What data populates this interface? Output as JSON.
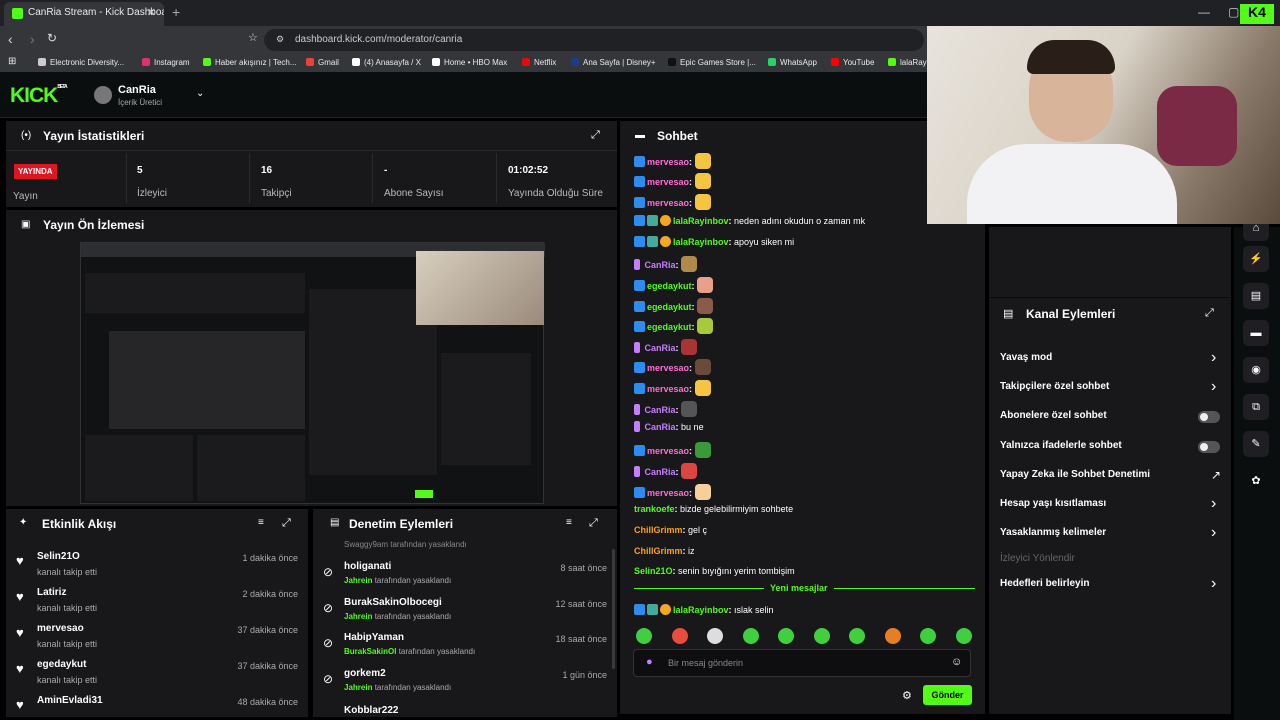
{
  "browser": {
    "tab_title": "CanRia Stream - Kick Dashboard",
    "url": "dashboard.kick.com/moderator/canria",
    "bookmarks": [
      "Electronic Diversity...",
      "Instagram",
      "Haber akışınız | Tech...",
      "Gmail",
      "(4) Anasayfa / X",
      "Home • HBO Max",
      "Netflix",
      "Ana Sayfa | Disney+",
      "Epic Games Store |...",
      "WhatsApp",
      "YouTube",
      "lalaRayi"
    ]
  },
  "header": {
    "logo": "KICK",
    "beta": "BETA",
    "channel": "CanRia",
    "role": "İçerik Üretici"
  },
  "stats": {
    "title": "Yayın İstatistikleri",
    "status": "YAYINDA",
    "status_label": "Yayın",
    "items": [
      {
        "value": "5",
        "label": "İzleyici"
      },
      {
        "value": "16",
        "label": "Takipçi"
      },
      {
        "value": "-",
        "label": "Abone Sayısı"
      },
      {
        "value": "01:02:52",
        "label": "Yayında Olduğu Süre"
      }
    ]
  },
  "preview": {
    "title": "Yayın Ön İzlemesi"
  },
  "activity": {
    "title": "Etkinlik Akışı",
    "items": [
      {
        "name": "Selin21O",
        "desc": "kanalı takip etti",
        "time": "1 dakika önce"
      },
      {
        "name": "Latiriz",
        "desc": "kanalı takip etti",
        "time": "2 dakika önce"
      },
      {
        "name": "mervesao",
        "desc": "kanalı takip etti",
        "time": "37 dakika önce"
      },
      {
        "name": "egedaykut",
        "desc": "kanalı takip etti",
        "time": "37 dakika önce"
      },
      {
        "name": "AminEvladi31",
        "desc": "",
        "time": "48 dakika önce"
      }
    ]
  },
  "modlog": {
    "title": "Denetim Eylemleri",
    "partial_top": "Swaggy9am tarafından yasaklandı",
    "partial_bottom": "Kobblar222",
    "items": [
      {
        "name": "holiganati",
        "by": "Jahrein",
        "suffix": "tarafından yasaklandı",
        "time": "8 saat önce"
      },
      {
        "name": "BurakSakinOlbocegi",
        "by": "Jahrein",
        "suffix": "tarafından yasaklandı",
        "time": "12 saat önce"
      },
      {
        "name": "HabipYaman",
        "by": "BurakSakinOl",
        "suffix": "tarafından yasaklandı",
        "time": "18 saat önce"
      },
      {
        "name": "gorkem2",
        "by": "Jahrein",
        "suffix": "tarafından yasaklandı",
        "time": "1 gün önce"
      }
    ]
  },
  "chat": {
    "title": "Sohbet",
    "new_messages": "Yeni mesajlar",
    "placeholder": "Bir mesaj gönderin",
    "send": "Gönder",
    "messages": [
      {
        "user": "mervesao",
        "color": "#ff6ad5",
        "text": "",
        "emote": "#f5c542"
      },
      {
        "user": "mervesao",
        "color": "#ff6ad5",
        "text": "",
        "emote": "#f5c542"
      },
      {
        "user": "mervesao",
        "color": "#ff6ad5",
        "text": "",
        "emote": "#f5c542"
      },
      {
        "user": "lalaRayinbov",
        "color": "#53fc18",
        "text": "neden adını okudun o zaman mk",
        "emote": ""
      },
      {
        "user": "lalaRayinbov",
        "color": "#53fc18",
        "text": "apoyu siken mi",
        "emote": ""
      },
      {
        "user": "CanRia",
        "color": "#c77dff",
        "text": "",
        "emote": "#b08a4a"
      },
      {
        "user": "egedaykut",
        "color": "#53fc18",
        "text": "",
        "emote": "#e8a08a"
      },
      {
        "user": "egedaykut",
        "color": "#53fc18",
        "text": "",
        "emote": "#8a5a4a"
      },
      {
        "user": "egedaykut",
        "color": "#53fc18",
        "text": "",
        "emote": "#a8c93a"
      },
      {
        "user": "CanRia",
        "color": "#c77dff",
        "text": "",
        "emote": "#a33"
      },
      {
        "user": "mervesao",
        "color": "#ff6ad5",
        "text": "",
        "emote": "#6a4a3a"
      },
      {
        "user": "mervesao",
        "color": "#ff6ad5",
        "text": "",
        "emote": "#f5c542"
      },
      {
        "user": "CanRia",
        "color": "#c77dff",
        "text": "",
        "emote": "#555"
      },
      {
        "user": "CanRia",
        "color": "#c77dff",
        "text": "bu ne",
        "emote": ""
      },
      {
        "user": "mervesao",
        "color": "#ff6ad5",
        "text": "",
        "emote": "#3a9a3a"
      },
      {
        "user": "CanRia",
        "color": "#c77dff",
        "text": "",
        "emote": "#d44"
      },
      {
        "user": "mervesao",
        "color": "#ff6ad5",
        "text": "",
        "emote": "#f5d09a"
      },
      {
        "user": "trankoefe",
        "color": "#53fc18",
        "text": "bizde gelebilirmiyim sohbete",
        "emote": ""
      },
      {
        "user": "ChillGrimm",
        "color": "#ff9f1c",
        "text": "gel ç",
        "emote": ""
      },
      {
        "user": "ChillGrimm",
        "color": "#ff9f1c",
        "text": "iz",
        "emote": ""
      },
      {
        "user": "Selin21O",
        "color": "#53fc18",
        "text": "senin bıyığını yerim tombişim",
        "emote": ""
      }
    ],
    "after_new": {
      "user": "lalaRayinbov",
      "color": "#53fc18",
      "text": "ıslak selin"
    }
  },
  "channel_actions": {
    "title": "Kanal Eylemleri",
    "items": [
      {
        "label": "Yavaş mod",
        "control": "chevron"
      },
      {
        "label": "Takipçilere özel sohbet",
        "control": "chevron"
      },
      {
        "label": "Abonelere özel sohbet",
        "control": "toggle"
      },
      {
        "label": "Yalnızca ifadelerle sohbet",
        "control": "toggle"
      },
      {
        "label": "Yapay Zeka ile Sohbet Denetimi",
        "control": "external"
      },
      {
        "label": "Hesap yaşı kısıtlaması",
        "control": "chevron"
      },
      {
        "label": "Yasaklanmış kelimeler",
        "control": "chevron"
      },
      {
        "label": "İzleyici Yönlendir",
        "control": "disabled"
      },
      {
        "label": "Hedefleri belirleyin",
        "control": "chevron"
      }
    ]
  }
}
